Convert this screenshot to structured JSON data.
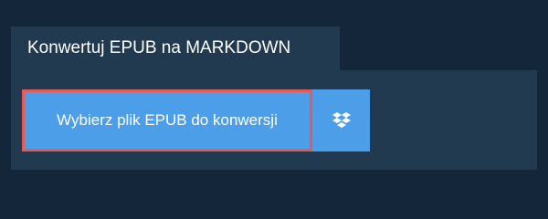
{
  "converter": {
    "title": "Konwertuj EPUB na MARKDOWN",
    "upload_label": "Wybierz plik EPUB do konwersji",
    "dropbox_icon": "dropbox-icon"
  },
  "colors": {
    "page_background": "#13263a",
    "panel_background": "#223a50",
    "button_background": "#4d9ee8",
    "focus_outline": "#e35a57",
    "text": "#ffffff"
  }
}
